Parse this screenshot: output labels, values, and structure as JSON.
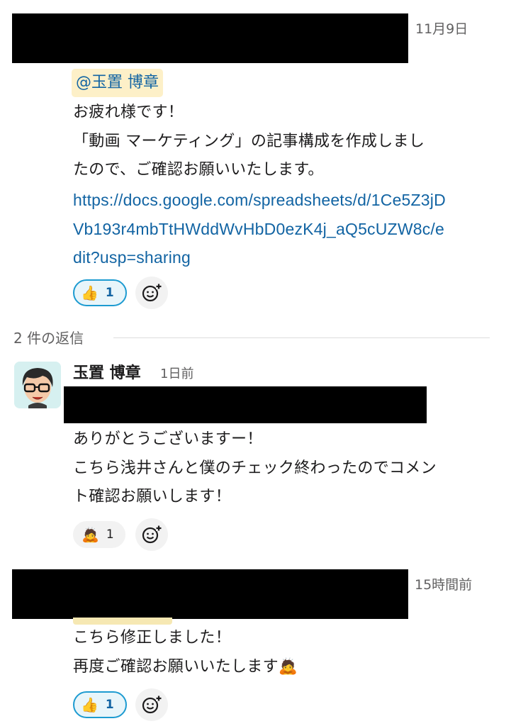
{
  "messages": [
    {
      "time": "11月9日",
      "mention": "@玉置 博章",
      "lines": [
        "お疲れ様です！",
        "「動画 マーケティング」の記事構成を作成しまし",
        "たので、ご確認お願いいたします。"
      ],
      "link_lines": [
        "https://docs.google.com/spreadsheets/d/1Ce5Z3jD",
        "Vb193r4mbTtHWddWvHbD0ezK4j_aQ5cUZW8c/e",
        "dit?usp=sharing"
      ],
      "reaction": {
        "emoji": "👍",
        "count": "1",
        "active": true
      }
    }
  ],
  "thread_divider": "2 件の返信",
  "reply1": {
    "author": "玉置 博章",
    "time": "1日前",
    "lines": [
      "ありがとうございますー！",
      "こちら浅井さんと僕のチェック終わったのでコメン",
      "ト確認お願いします！"
    ],
    "reaction": {
      "emoji": "🙇",
      "count": "1",
      "active": false
    }
  },
  "reply2": {
    "time": "15時間前",
    "lines": [
      "こちら修正しました！",
      "再度ご確認お願いいたします"
    ],
    "trailing_emoji": "🙇",
    "reaction": {
      "emoji": "👍",
      "count": "1",
      "active": true
    }
  },
  "icons": {
    "add_reaction": "add-reaction-icon",
    "avatar": "avatar"
  },
  "colors": {
    "link": "#1264a3",
    "mention_bg": "#fdf0c8",
    "active_reaction_border": "#1d9bd1"
  }
}
